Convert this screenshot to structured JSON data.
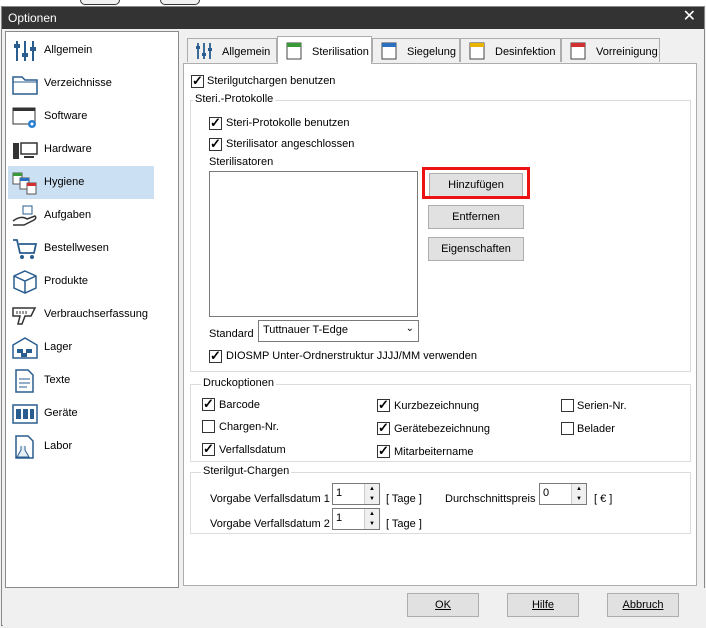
{
  "window": {
    "title": "Optionen",
    "close_glyph": "✕"
  },
  "sidebar": {
    "items": [
      {
        "label": "Allgemein",
        "icon": "sliders-icon"
      },
      {
        "label": "Verzeichnisse",
        "icon": "folder-icon"
      },
      {
        "label": "Software",
        "icon": "software-gear-icon"
      },
      {
        "label": "Hardware",
        "icon": "computer-icon"
      },
      {
        "label": "Hygiene",
        "icon": "hygiene-icon",
        "selected": true
      },
      {
        "label": "Aufgaben",
        "icon": "hand-task-icon"
      },
      {
        "label": "Bestellwesen",
        "icon": "cart-icon"
      },
      {
        "label": "Produkte",
        "icon": "box-icon"
      },
      {
        "label": "Verbrauchserfassung",
        "icon": "barcode-scanner-icon"
      },
      {
        "label": "Lager",
        "icon": "warehouse-icon"
      },
      {
        "label": "Texte",
        "icon": "document-icon"
      },
      {
        "label": "Geräte",
        "icon": "devices-icon"
      },
      {
        "label": "Labor",
        "icon": "lab-icon"
      }
    ]
  },
  "tabs": [
    {
      "label": "Allgemein",
      "icon": "sliders-icon"
    },
    {
      "label": "Sterilisation",
      "icon": "book-green-icon",
      "active": true
    },
    {
      "label": "Siegelung",
      "icon": "book-blue-icon"
    },
    {
      "label": "Desinfektion",
      "icon": "book-yellow-icon"
    },
    {
      "label": "Vorreinigung",
      "icon": "book-red-icon"
    }
  ],
  "sterilisation": {
    "use_batches": {
      "label": "Sterilgutchargen benutzen",
      "checked": true
    },
    "protocols_group": "Steri.-Protokolle",
    "use_protocols": {
      "label": "Steri-Protokolle benutzen",
      "checked": true
    },
    "connected": {
      "label": "Sterilisator angeschlossen",
      "checked": true
    },
    "sterilizers_label": "Sterilisatoren",
    "add_button": "Hinzufügen",
    "remove_button": "Entfernen",
    "properties_button": "Eigenschaften",
    "standard_label": "Standard",
    "standard_value": "Tuttnauer T-Edge",
    "diosmp": {
      "label": "DIOSMP Unter-Ordnerstruktur JJJJ/MM verwenden",
      "checked": true
    }
  },
  "print_options": {
    "title": "Druckoptionen",
    "barcode": {
      "label": "Barcode",
      "checked": true
    },
    "batch_no": {
      "label": "Chargen-Nr.",
      "checked": false
    },
    "expiry": {
      "label": "Verfallsdatum",
      "checked": true
    },
    "short_name": {
      "label": "Kurzbezeichnung",
      "checked": true
    },
    "device_name": {
      "label": "Gerätebezeichnung",
      "checked": true
    },
    "employee": {
      "label": "Mitarbeitername",
      "checked": true
    },
    "serial": {
      "label": "Serien-Nr.",
      "checked": false
    },
    "loader": {
      "label": "Belader",
      "checked": false
    }
  },
  "batches": {
    "title": "Sterilgut-Chargen",
    "expiry1_label": "Vorgabe Verfallsdatum 1",
    "expiry1_value": "1",
    "expiry1_unit": "[ Tage ]",
    "expiry2_label": "Vorgabe Verfallsdatum 2",
    "expiry2_value": "1",
    "expiry2_unit": "[ Tage ]",
    "avg_price_label": "Durchschnittspreis",
    "avg_price_value": "0",
    "avg_price_unit": "[ € ]"
  },
  "footer": {
    "ok": "OK",
    "help": "Hilfe",
    "cancel": "Abbruch"
  },
  "colors": {
    "selection": "#cce0f4",
    "highlight": "#e11111",
    "titlebar": "#333333"
  }
}
